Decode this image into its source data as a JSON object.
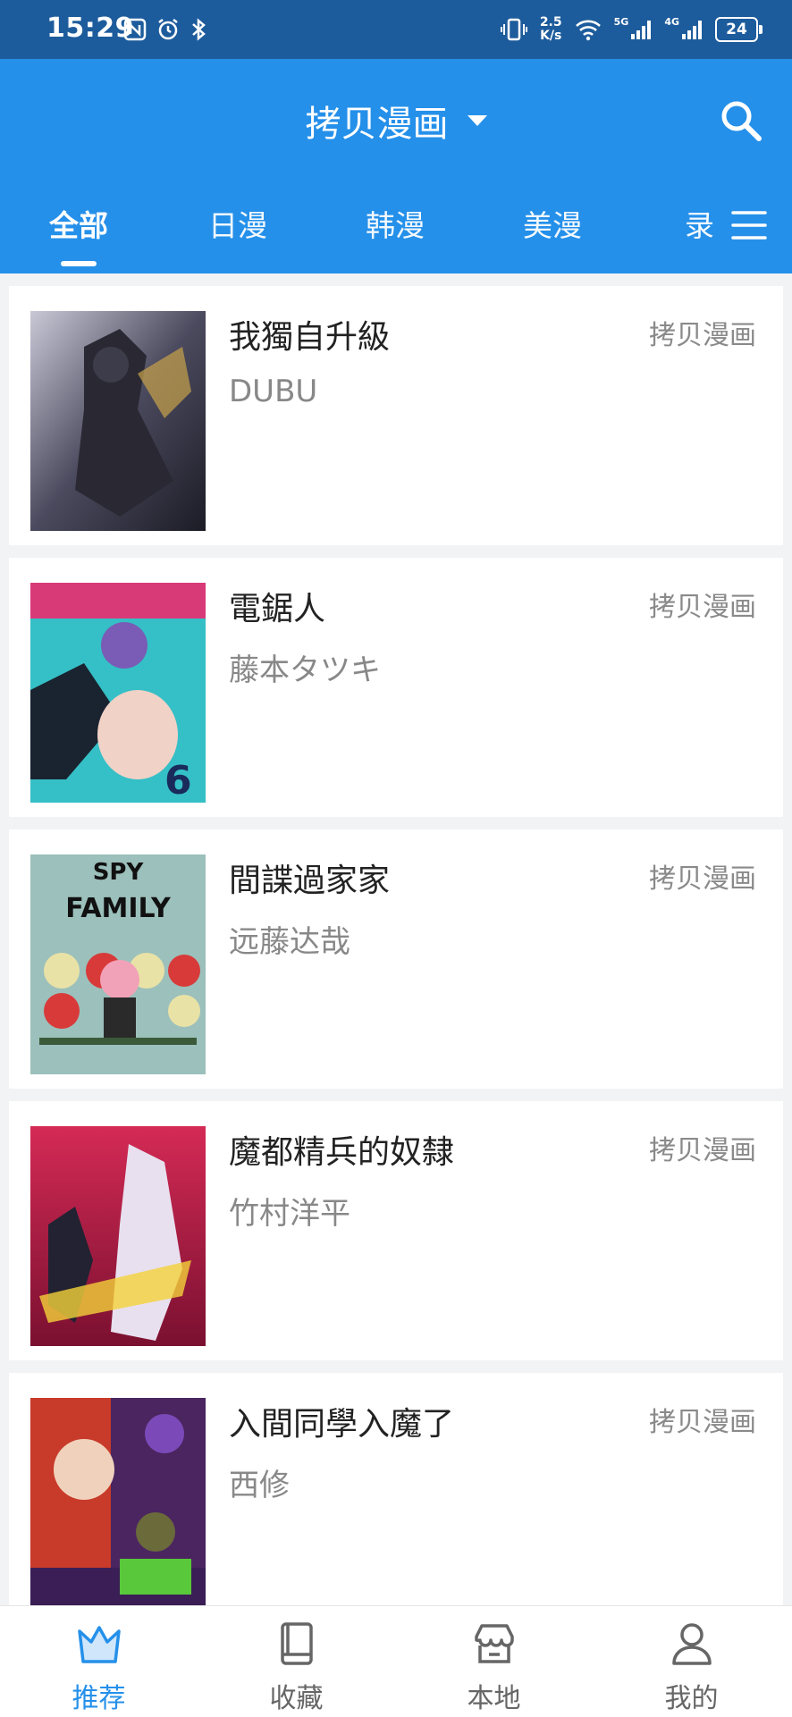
{
  "status_bar": {
    "time": "15:29",
    "speed_value": "2.5",
    "speed_unit": "K/s",
    "net1": "5G",
    "net2": "4G",
    "battery": "24"
  },
  "app_bar": {
    "title": "拷贝漫画",
    "tabs": [
      "全部",
      "日漫",
      "韩漫",
      "美漫",
      "录"
    ],
    "active_tab": 0
  },
  "comics": [
    {
      "title": "我獨自升級",
      "author": "DUBU",
      "source": "拷贝漫画",
      "cover_color": "#3a3a46"
    },
    {
      "title": "電鋸人",
      "author": "藤本タツキ",
      "source": "拷贝漫画",
      "cover_color": "#2fb7c0"
    },
    {
      "title": "間諜過家家",
      "author": "远藤达哉",
      "source": "拷贝漫画",
      "cover_color": "#8fb7b3"
    },
    {
      "title": "魔都精兵的奴隸",
      "author": "竹村洋平",
      "source": "拷贝漫画",
      "cover_color": "#c2224a"
    },
    {
      "title": "入間同學入魔了",
      "author": "西修",
      "source": "拷贝漫画",
      "cover_color": "#5a2a66"
    }
  ],
  "bottom_nav": [
    {
      "label": "推荐",
      "icon": "crown-icon",
      "active": true
    },
    {
      "label": "收藏",
      "icon": "book-icon",
      "active": false
    },
    {
      "label": "本地",
      "icon": "store-icon",
      "active": false
    },
    {
      "label": "我的",
      "icon": "user-icon",
      "active": false
    }
  ],
  "colors": {
    "primary": "#2590ea",
    "status_bar": "#1d5c9c",
    "background": "#f2f3f5"
  }
}
